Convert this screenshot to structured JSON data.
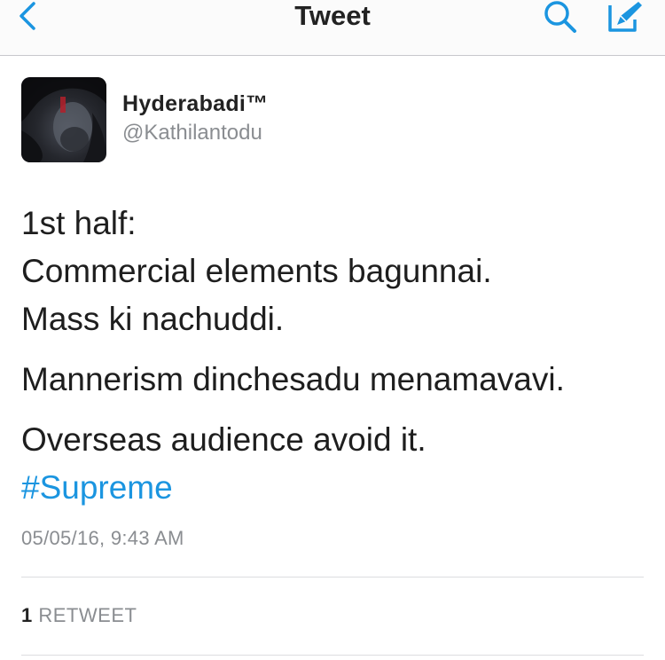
{
  "navbar": {
    "title": "Tweet",
    "back_icon": "chevron-left-icon",
    "search_icon": "search-icon",
    "compose_icon": "compose-icon",
    "accent_color": "#1b95e0"
  },
  "tweet": {
    "author": {
      "display_name": "Hyderabadi™",
      "handle": "@Kathilantodu"
    },
    "lines": [
      "1st half:",
      "Commercial elements bagunnai.",
      "Mass ki nachuddi.",
      "Mannerism dinchesadu menamavavi.",
      "Overseas audience avoid it."
    ],
    "hashtag": "#Supreme",
    "timestamp": "05/05/16, 9:43 AM",
    "stats": {
      "retweet_count": "1",
      "retweet_label": "RETWEET"
    }
  }
}
